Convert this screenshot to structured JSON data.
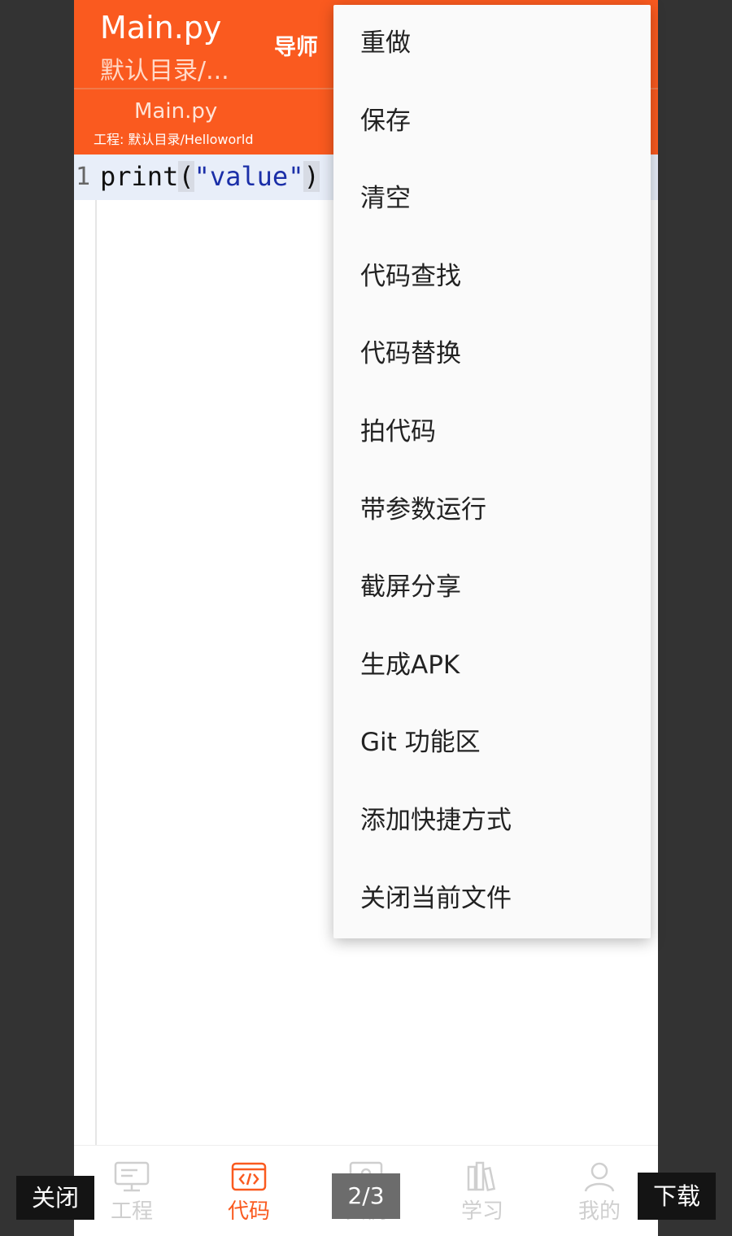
{
  "app": {
    "title": "Main.py",
    "subtitle": "默认目录/...",
    "mentor_label": "导师",
    "accent_color": "#fa5a1f"
  },
  "tab": {
    "file_name": "Main.py",
    "project_path": "工程:  默认目录/Helloworld"
  },
  "editor": {
    "line_number": "1",
    "code_fn": "print",
    "code_open": "(",
    "code_string": "\"value\"",
    "code_close": ")"
  },
  "menu": {
    "items": [
      "重做",
      "保存",
      "清空",
      "代码查找",
      "代码替换",
      "拍代码",
      "带参数运行",
      "截屏分享",
      "生成APK",
      "Git 功能区",
      "添加快捷方式",
      "关闭当前文件"
    ]
  },
  "bottom_nav": {
    "items": [
      {
        "label": "工程",
        "icon": "monitor-icon"
      },
      {
        "label": "代码",
        "icon": "code-icon",
        "active": true
      },
      {
        "label": "实例",
        "icon": "example-icon"
      },
      {
        "label": "学习",
        "icon": "books-icon"
      },
      {
        "label": "我的",
        "icon": "user-icon"
      }
    ]
  },
  "viewer": {
    "close_label": "关闭",
    "download_label": "下载",
    "page_indicator": "2/3"
  }
}
